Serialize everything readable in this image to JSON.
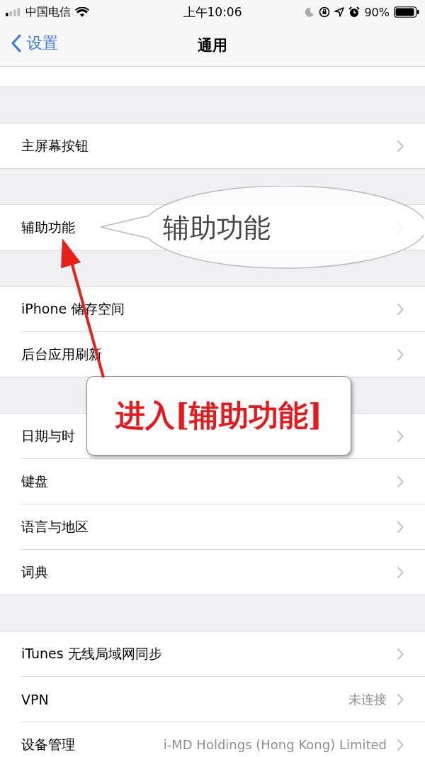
{
  "status_bar": {
    "carrier": "中国电信",
    "time": "上午10:06",
    "battery": "90%"
  },
  "nav": {
    "back": "设置",
    "title": "通用"
  },
  "sections": [
    {
      "rows": [
        {
          "label": "主屏幕按钮"
        }
      ]
    },
    {
      "rows": [
        {
          "label": "辅助功能"
        }
      ]
    },
    {
      "rows": [
        {
          "label": "iPhone 储存空间"
        },
        {
          "label": "后台应用刷新"
        }
      ]
    },
    {
      "rows": [
        {
          "label": "日期与时"
        },
        {
          "label": "键盘"
        },
        {
          "label": "语言与地区"
        },
        {
          "label": "词典"
        }
      ]
    },
    {
      "rows": [
        {
          "label": "iTunes 无线局域网同步"
        },
        {
          "label": "VPN",
          "detail": "未连接"
        },
        {
          "label": "设备管理",
          "detail": "i-MD Holdings (Hong Kong) Limited"
        }
      ]
    }
  ],
  "callouts": [
    {
      "kind": "bubble",
      "text": "辅助功能"
    },
    {
      "kind": "box",
      "text": "进入[辅助功能]"
    }
  ]
}
